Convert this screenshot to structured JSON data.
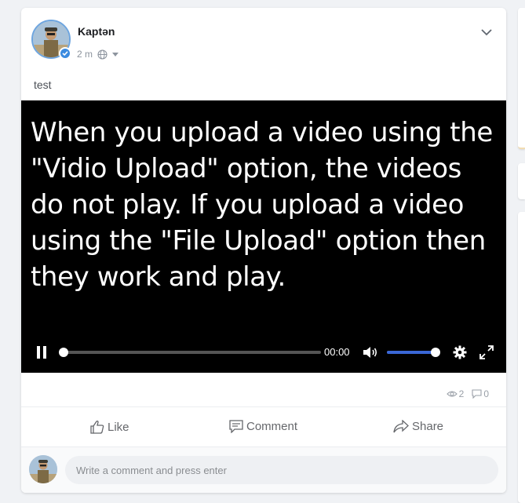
{
  "post": {
    "author": "Kaptən",
    "time": "2 m",
    "privacy_icon": "globe-icon",
    "text": "test"
  },
  "video": {
    "caption": "When you upload a video using the \"Vidio Upload\" option, the videos do not play. If you upload a video using the \"File Upload\" option then they work and play.",
    "current_time": "00:00",
    "progress": 0,
    "volume": 1.0,
    "state": "playing"
  },
  "stats": {
    "views": "2",
    "comments": "0"
  },
  "actions": {
    "like": "Like",
    "comment": "Comment",
    "share": "Share"
  },
  "comment_box": {
    "placeholder": "Write a comment and press enter"
  },
  "colors": {
    "accent": "#3b8be0",
    "volume_fill": "#3a67d6"
  }
}
